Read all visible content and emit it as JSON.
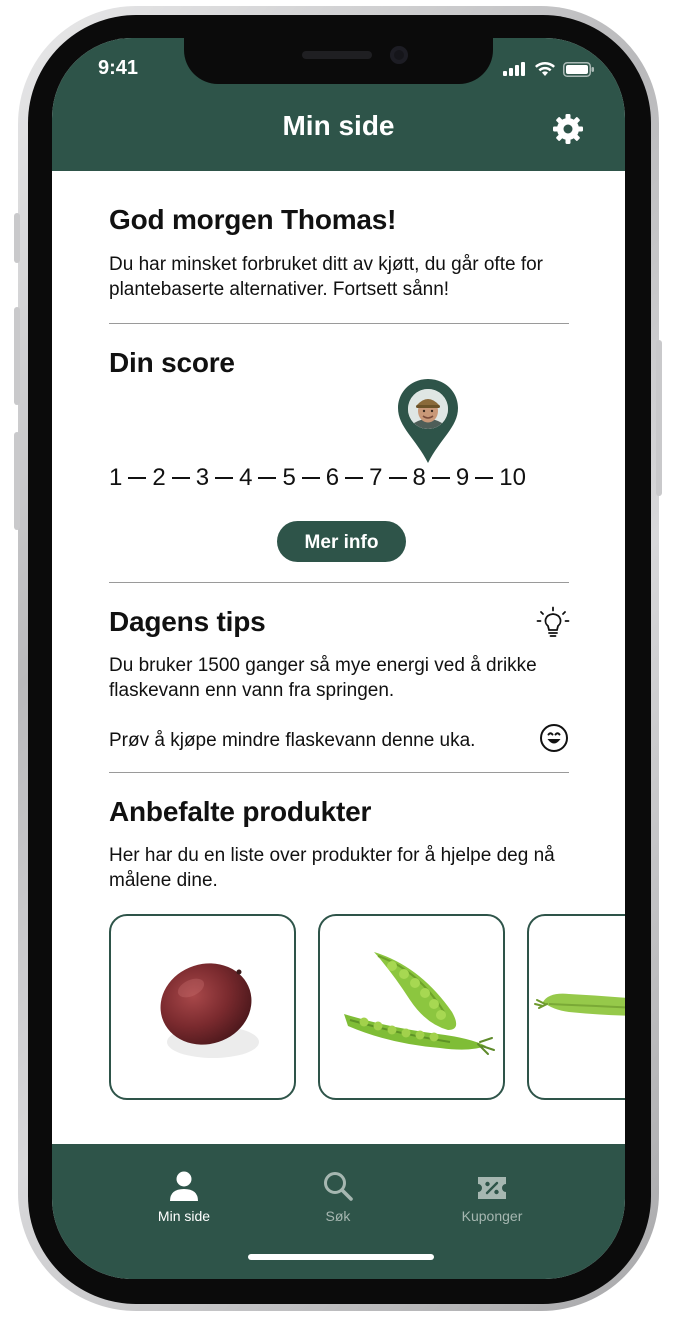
{
  "status_bar": {
    "time": "9:41"
  },
  "header": {
    "title": "Min side"
  },
  "greeting": {
    "title": "God morgen Thomas!",
    "body": "Du har minsket forbruket ditt av kjøtt, du går ofte for plantebaserte alternativer. Fortsett sånn!"
  },
  "score": {
    "title": "Din score",
    "scale": [
      "1",
      "2",
      "3",
      "4",
      "5",
      "6",
      "7",
      "8",
      "9",
      "10"
    ],
    "marker_value": 7.5,
    "button_label": "Mer info"
  },
  "tips": {
    "title": "Dagens tips",
    "body": "Du bruker 1500 ganger så mye energi ved å drikke flaskevann enn vann fra springen.",
    "suggestion": "Prøv å kjøpe mindre flaskevann denne uka."
  },
  "recommended": {
    "title": "Anbefalte produkter",
    "body": "Her har du en liste over produkter for å hjelpe deg nå målene dine.",
    "products": [
      {
        "name": "mango"
      },
      {
        "name": "green peas"
      },
      {
        "name": "pea pod"
      }
    ]
  },
  "tabbar": {
    "tabs": [
      {
        "label": "Min side",
        "icon": "person-icon",
        "active": true
      },
      {
        "label": "Søk",
        "icon": "search-icon",
        "active": false
      },
      {
        "label": "Kuponger",
        "icon": "coupon-icon",
        "active": false
      }
    ]
  },
  "colors": {
    "primary": "#2e5449",
    "tab_inactive": "#a6b7b1",
    "text": "#111111"
  }
}
